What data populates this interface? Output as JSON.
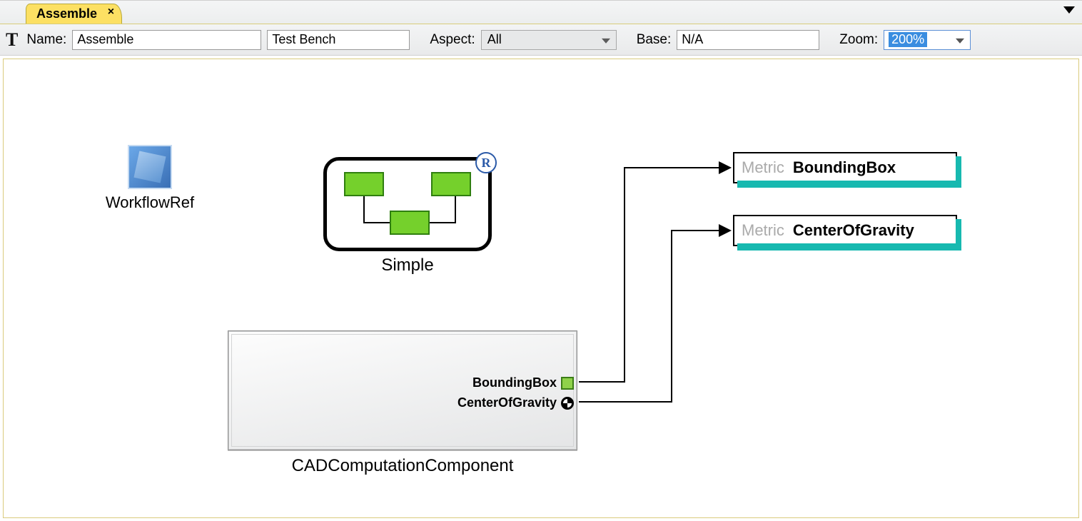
{
  "tab": {
    "title": "Assemble"
  },
  "toolbar": {
    "nameLabel": "Name:",
    "nameValue": "Assemble",
    "kind": "Test Bench",
    "aspectLabel": "Aspect:",
    "aspectValue": "All",
    "baseLabel": "Base:",
    "baseValue": "N/A",
    "zoomLabel": "Zoom:",
    "zoomValue": "200%"
  },
  "workflowRef": {
    "label": "WorkflowRef"
  },
  "simple": {
    "label": "Simple",
    "badge": "R"
  },
  "cad": {
    "label": "CADComputationComponent",
    "ports": {
      "boundingBox": "BoundingBox",
      "centerOfGravity": "CenterOfGravity"
    }
  },
  "metrics": {
    "typeLabel": "Metric",
    "boundingBox": "BoundingBox",
    "centerOfGravity": "CenterOfGravity"
  }
}
